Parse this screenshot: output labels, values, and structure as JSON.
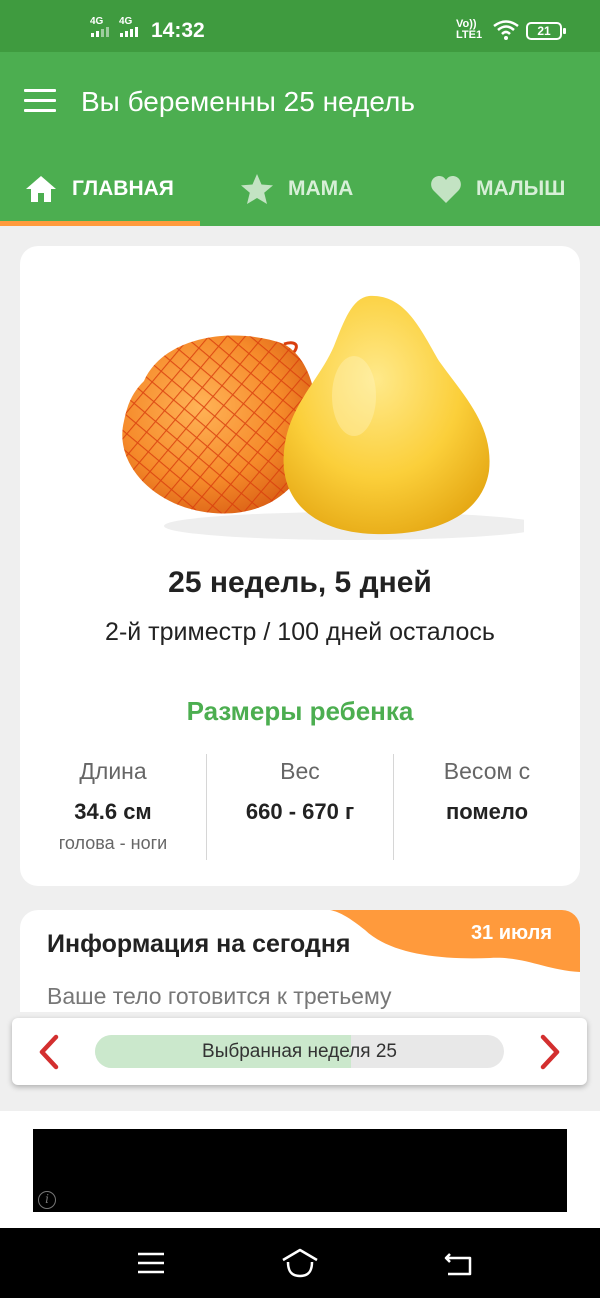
{
  "status_bar": {
    "network1": "4G",
    "network2": "4G",
    "time": "14:32",
    "volte_top": "Vo))",
    "volte_bottom": "LTE1",
    "battery": "21"
  },
  "app_bar": {
    "title": "Вы беременны 25 недель",
    "menu_icon": "hamburger-menu-icon"
  },
  "tabs": [
    {
      "label": "ГЛАВНАЯ",
      "icon": "home-icon",
      "active": true
    },
    {
      "label": "МАМА",
      "icon": "star-icon",
      "active": false
    },
    {
      "label": "МАЛЫШ",
      "icon": "heart-icon",
      "active": false
    }
  ],
  "week_card": {
    "image": "pomelo-fruit",
    "title": "25 недель, 5 дней",
    "subtitle": "2-й триместр / 100 дней осталось",
    "sizes_title": "Размеры ребенка",
    "stats": [
      {
        "label": "Длина",
        "value": "34.6 см",
        "note": "голова - ноги"
      },
      {
        "label": "Вес",
        "value": "660 - 670 г",
        "note": ""
      },
      {
        "label": "Весом с",
        "value": "помело",
        "note": ""
      }
    ]
  },
  "info_card": {
    "title": "Информация на сегодня",
    "date": "31 июля",
    "text": "Ваше тело готовится к третьему"
  },
  "week_selector": {
    "label": "Выбранная неделя 25",
    "progress": 0.625
  },
  "colors": {
    "status_bar": "#3f9b3f",
    "primary": "#4cae50",
    "accent": "#ff9a3c",
    "arrow": "#d32f2f",
    "progress_fill": "#cbe8cc"
  }
}
